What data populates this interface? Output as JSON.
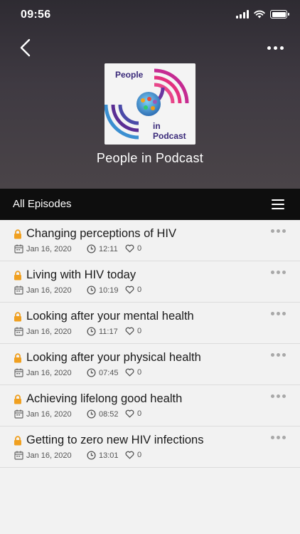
{
  "status_bar": {
    "time": "09:56"
  },
  "podcast": {
    "cover_text_top": "People",
    "cover_text_bottom_1": "in",
    "cover_text_bottom_2": "Podcast",
    "title": "People in Podcast"
  },
  "episodes_bar": {
    "label": "All Episodes"
  },
  "episodes": [
    {
      "title": "Changing perceptions of HIV",
      "date": "Jan 16, 2020",
      "duration": "12:11",
      "likes": "0"
    },
    {
      "title": "Living with HIV today",
      "date": "Jan 16, 2020",
      "duration": "10:19",
      "likes": "0"
    },
    {
      "title": "Looking after your mental health",
      "date": "Jan 16, 2020",
      "duration": "11:17",
      "likes": "0"
    },
    {
      "title": "Looking after your physical health",
      "date": "Jan 16, 2020",
      "duration": "07:45",
      "likes": "0"
    },
    {
      "title": "Achieving lifelong good health",
      "date": "Jan 16, 2020",
      "duration": "08:52",
      "likes": "0"
    },
    {
      "title": "Getting to zero new HIV infections",
      "date": "Jan 16, 2020",
      "duration": "13:01",
      "likes": "0"
    }
  ],
  "icons": {
    "back": "chevron-left-icon",
    "more": "more-horizontal-icon",
    "menu": "hamburger-menu-icon",
    "lock": "lock-icon",
    "calendar": "calendar-icon",
    "clock": "clock-icon",
    "heart": "heart-icon"
  },
  "colors": {
    "header_bg": "#3a363c",
    "episodes_bar_bg": "#0e0e0e",
    "list_bg": "#f2f2f2",
    "lock": "#f0a020",
    "cover_magenta": "#d42a8c",
    "cover_purple": "#5a2d91"
  }
}
